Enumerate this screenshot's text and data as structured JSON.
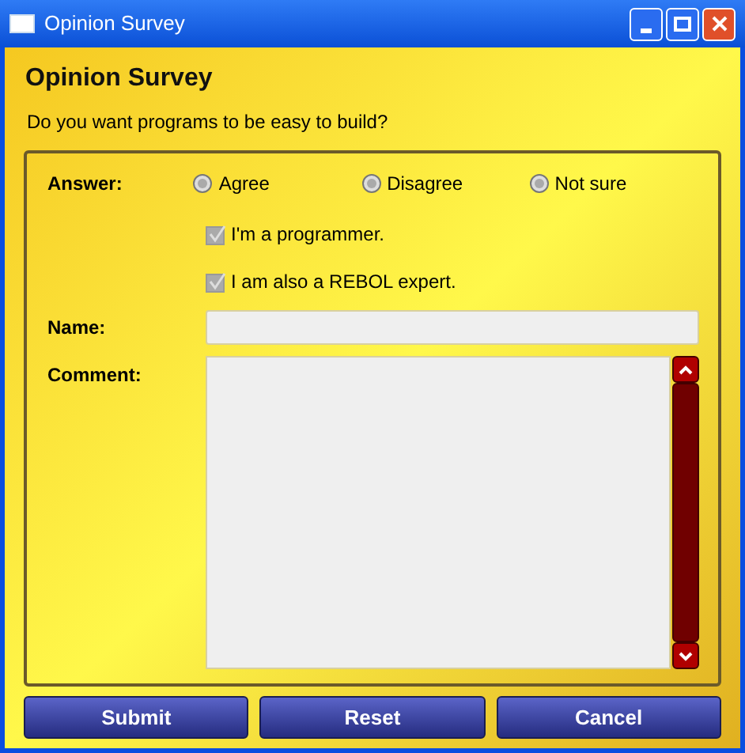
{
  "window": {
    "title": "Opinion Survey"
  },
  "heading": "Opinion Survey",
  "question": "Do you want programs to be easy to build?",
  "answer": {
    "label": "Answer:",
    "options": [
      {
        "label": "Agree",
        "selected": false
      },
      {
        "label": "Disagree",
        "selected": false
      },
      {
        "label": "Not sure",
        "selected": false
      }
    ]
  },
  "checkboxes": [
    {
      "label": "I'm a programmer.",
      "checked": true
    },
    {
      "label": "I am also a REBOL expert.",
      "checked": true
    }
  ],
  "name": {
    "label": "Name:"
  },
  "comment": {
    "label": "Comment:"
  },
  "buttons": [
    "Submit",
    "Reset",
    "Cancel"
  ]
}
